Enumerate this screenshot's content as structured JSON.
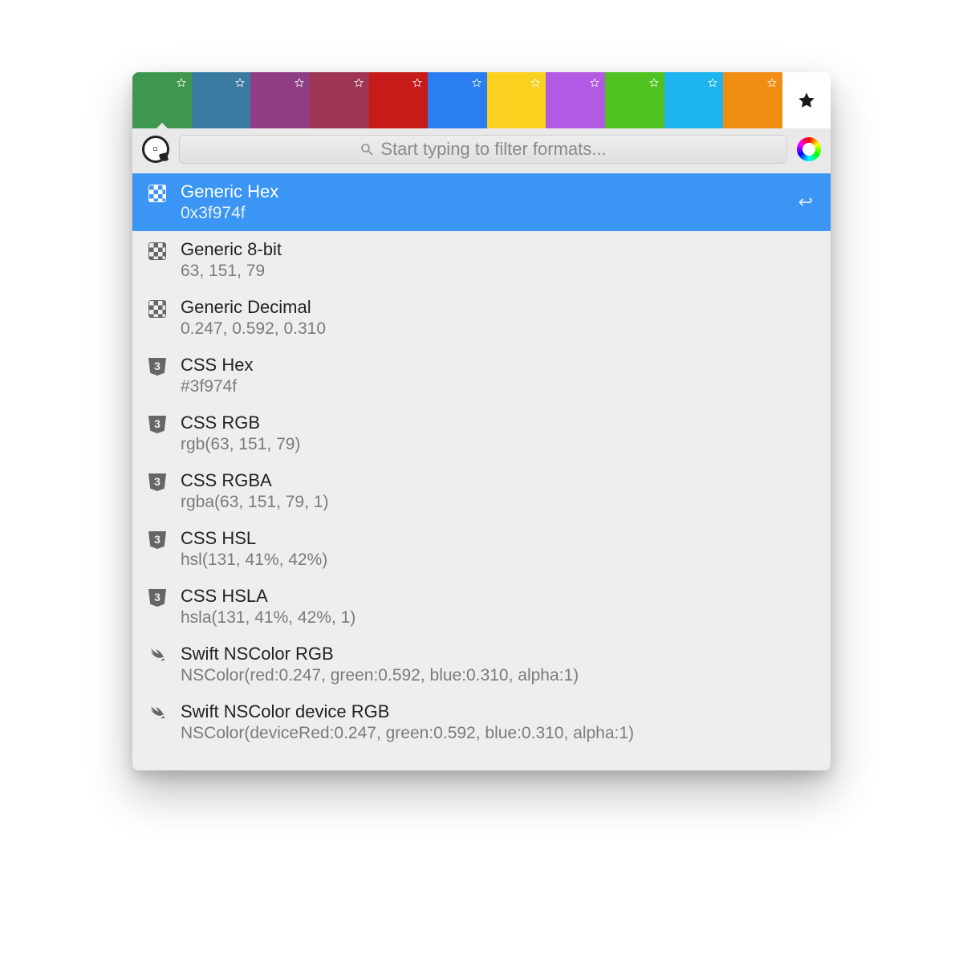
{
  "color_tabs": [
    {
      "color": "#3f974f",
      "selected": true
    },
    {
      "color": "#3a79a0",
      "selected": false
    },
    {
      "color": "#8f3e84",
      "selected": false
    },
    {
      "color": "#9e3553",
      "selected": false
    },
    {
      "color": "#c71b19",
      "selected": false
    },
    {
      "color": "#2b7ef2",
      "selected": false
    },
    {
      "color": "#f9d11e",
      "selected": false
    },
    {
      "color": "#b25ae3",
      "selected": false
    },
    {
      "color": "#4fc221",
      "selected": false
    },
    {
      "color": "#1cb3ef",
      "selected": false
    },
    {
      "color": "#f28d13",
      "selected": false
    }
  ],
  "search": {
    "placeholder": "Start typing to filter formats..."
  },
  "enter_hint_glyph": "↩",
  "formats": [
    {
      "icon": "checker",
      "title": "Generic Hex",
      "value": "0x3f974f",
      "selected": true
    },
    {
      "icon": "checker",
      "title": "Generic 8-bit",
      "value": "63, 151, 79",
      "selected": false
    },
    {
      "icon": "checker",
      "title": "Generic Decimal",
      "value": "0.247, 0.592, 0.310",
      "selected": false
    },
    {
      "icon": "css",
      "title": "CSS Hex",
      "value": "#3f974f",
      "selected": false
    },
    {
      "icon": "css",
      "title": "CSS RGB",
      "value": "rgb(63, 151, 79)",
      "selected": false
    },
    {
      "icon": "css",
      "title": "CSS RGBA",
      "value": "rgba(63, 151, 79, 1)",
      "selected": false
    },
    {
      "icon": "css",
      "title": "CSS HSL",
      "value": "hsl(131, 41%, 42%)",
      "selected": false
    },
    {
      "icon": "css",
      "title": "CSS HSLA",
      "value": "hsla(131, 41%, 42%, 1)",
      "selected": false
    },
    {
      "icon": "swift",
      "title": "Swift NSColor RGB",
      "value": "NSColor(red:0.247, green:0.592, blue:0.310, alpha:1)",
      "selected": false
    },
    {
      "icon": "swift",
      "title": "Swift NSColor device RGB",
      "value": "NSColor(deviceRed:0.247, green:0.592, blue:0.310, alpha:1)",
      "selected": false
    }
  ]
}
